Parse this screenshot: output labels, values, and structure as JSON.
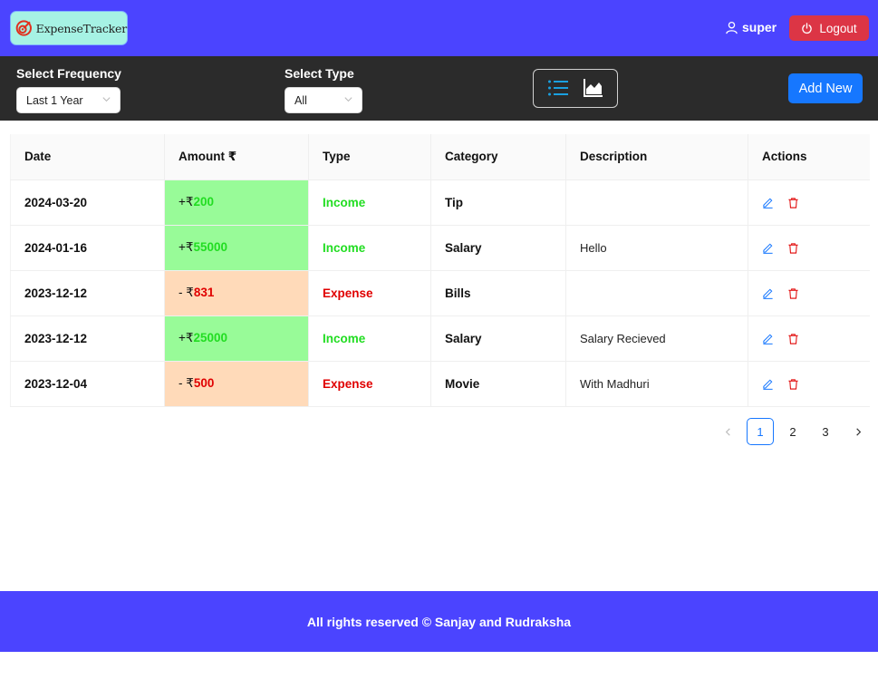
{
  "header": {
    "logo_text": "ExpenseTracker",
    "username": "super",
    "logout_label": "Logout"
  },
  "filters": {
    "frequency_label": "Select Frequency",
    "frequency_value": "Last 1 Year",
    "type_label": "Select Type",
    "type_value": "All",
    "view_icons": [
      "list-icon",
      "area-chart-icon"
    ],
    "add_new_label": "Add New"
  },
  "table": {
    "headers": [
      "Date",
      "Amount ₹",
      "Type",
      "Category",
      "Description",
      "Actions"
    ],
    "rows": [
      {
        "date": "2024-03-20",
        "sign": "+₹",
        "amount": "200",
        "type": "Income",
        "category": "Tip",
        "description": ""
      },
      {
        "date": "2024-01-16",
        "sign": "+₹",
        "amount": "55000",
        "type": "Income",
        "category": "Salary",
        "description": "Hello"
      },
      {
        "date": "2023-12-12",
        "sign": "- ₹",
        "amount": "831",
        "type": "Expense",
        "category": "Bills",
        "description": ""
      },
      {
        "date": "2023-12-12",
        "sign": "+₹",
        "amount": "25000",
        "type": "Income",
        "category": "Salary",
        "description": "Salary Recieved"
      },
      {
        "date": "2023-12-04",
        "sign": "- ₹",
        "amount": "500",
        "type": "Expense",
        "category": "Movie",
        "description": "With Madhuri"
      }
    ]
  },
  "pagination": {
    "pages": [
      "1",
      "2",
      "3"
    ],
    "current": "1"
  },
  "footer": {
    "text": "All rights reserved © Sanjay and Rudraksha"
  },
  "colors": {
    "brand": "#4b44ff",
    "income_bg": "#98fb98",
    "expense_bg": "#ffdab9",
    "income_text": "#22dd22",
    "expense_text": "#e00000",
    "primary_button": "#1677ff",
    "logout_button": "#dc3545"
  }
}
